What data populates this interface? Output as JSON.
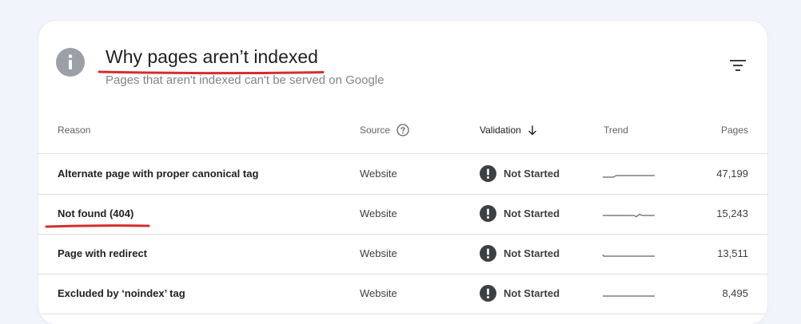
{
  "header": {
    "title": "Why pages aren’t indexed",
    "subtitle": "Pages that aren't indexed can't be served on Google"
  },
  "icons": {
    "info": "info-icon",
    "filter": "filter-icon",
    "help": "help-circle-icon",
    "sort": "arrow-down-icon",
    "status": "exclamation-circle-icon"
  },
  "table": {
    "columns": {
      "reason": "Reason",
      "source": "Source",
      "validation": "Validation",
      "trend": "Trend",
      "pages": "Pages"
    },
    "rows": [
      {
        "reason": "Alternate page with proper canonical tag",
        "source": "Website",
        "validation": "Not Started",
        "pages": "47,199"
      },
      {
        "reason": "Not found (404)",
        "source": "Website",
        "validation": "Not Started",
        "pages": "15,243"
      },
      {
        "reason": "Page with redirect",
        "source": "Website",
        "validation": "Not Started",
        "pages": "13,511"
      },
      {
        "reason": "Excluded by ‘noindex’ tag",
        "source": "Website",
        "validation": "Not Started",
        "pages": "8,495"
      }
    ]
  },
  "colors": {
    "annotation": "#d32f2f",
    "status_icon": "#3c4043",
    "info_icon": "#9aa0a6"
  }
}
